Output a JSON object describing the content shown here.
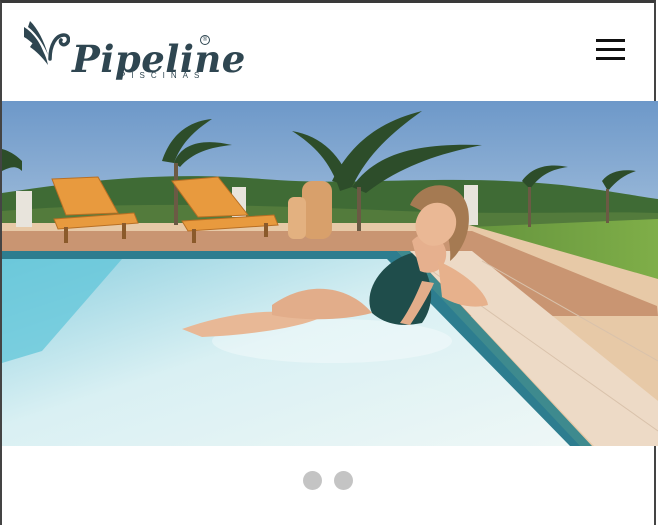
{
  "brand": {
    "name": "Pipeline",
    "subtitle": "PISCINAS",
    "mark": "®"
  },
  "header": {
    "menu_icon": "hamburger-menu-icon"
  },
  "hero": {
    "image": "woman-in-pool-scene",
    "slides": 2,
    "active_slide": 1
  },
  "colors": {
    "brand": "#2f4651",
    "pool": "#bfe3ea",
    "deck": "#e7c9a7",
    "dot": "#c4c4c4"
  }
}
